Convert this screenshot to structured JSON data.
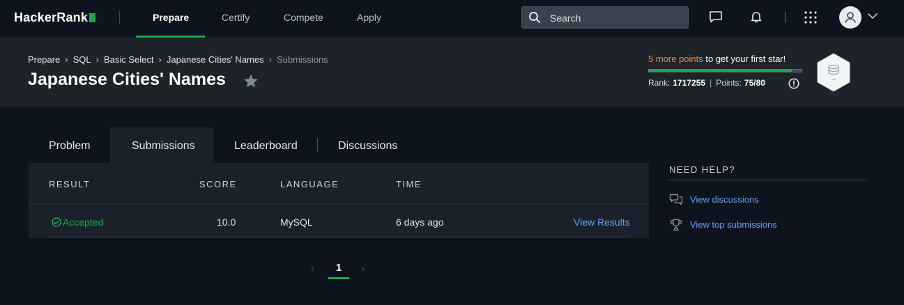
{
  "nav": {
    "logo": "HackerRank",
    "items": [
      "Prepare",
      "Certify",
      "Compete",
      "Apply"
    ],
    "active": "Prepare",
    "search_placeholder": "Search"
  },
  "header": {
    "breadcrumb": [
      "Prepare",
      "SQL",
      "Basic Select",
      "Japanese Cities' Names",
      "Submissions"
    ],
    "title": "Japanese Cities' Names",
    "points_highlight": "5 more points",
    "points_rest": " to get your first star!",
    "progress_fraction": 0.9375,
    "rank_label": "Rank:",
    "rank_value": "1717255",
    "points_label": "Points:",
    "points_value": "75/80"
  },
  "tabs": [
    "Problem",
    "Submissions",
    "Leaderboard",
    "Discussions"
  ],
  "active_tab": "Submissions",
  "table": {
    "headers": [
      "RESULT",
      "SCORE",
      "LANGUAGE",
      "TIME"
    ],
    "rows": [
      {
        "result": "Accepted",
        "score": "10.0",
        "language": "MySQL",
        "time": "6 days ago",
        "action": "View Results"
      }
    ]
  },
  "pagination": {
    "current": "1",
    "prev": "‹",
    "next": "›"
  },
  "help": {
    "title": "NEED HELP?",
    "links": [
      "View discussions",
      "View top submissions"
    ]
  },
  "colors": {
    "accent_green": "#1ba94c",
    "link_blue": "#6a9bf4",
    "highlight_orange": "#f08a3e",
    "background": "#0e141e"
  }
}
